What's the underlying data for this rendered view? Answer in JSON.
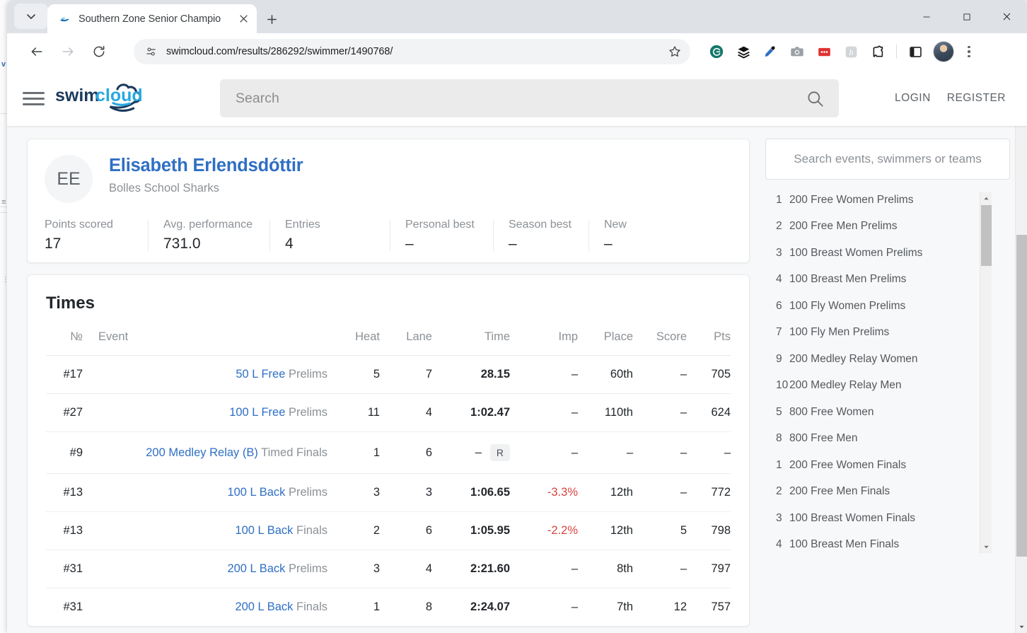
{
  "browser": {
    "tab": {
      "title": "Southern Zone Senior Champio",
      "favicon_name": "swimcloud-favicon"
    },
    "new_tab_label": "+",
    "url": "swimcloud.com/results/286292/swimmer/1490768/",
    "window_controls": {
      "minimize": "—",
      "maximize": "□",
      "close": "✕"
    },
    "extensions": [
      {
        "name": "grammarly-extension-icon",
        "label": "G"
      },
      {
        "name": "layers-extension-icon",
        "label": ""
      },
      {
        "name": "eyedropper-extension-icon",
        "label": ""
      },
      {
        "name": "screenshot-camera-extension-icon",
        "label": ""
      },
      {
        "name": "red-dots-extension-icon",
        "label": ""
      },
      {
        "name": "honey-extension-icon",
        "label": "h"
      },
      {
        "name": "extensions-puzzle-icon",
        "label": ""
      }
    ],
    "side_panel_name": "side-panel-icon",
    "profile_name": "chrome-profile-avatar",
    "menu_name": "chrome-menu-icon"
  },
  "site_header": {
    "logo_text_1": "swim",
    "logo_text_2": "cloud",
    "search_placeholder": "Search",
    "login_label": "LOGIN",
    "register_label": "REGISTER"
  },
  "profile": {
    "initials": "EE",
    "name": "Elisabeth Erlendsdóttir",
    "team": "Bolles School Sharks",
    "stats": [
      {
        "label": "Points scored",
        "value": "17"
      },
      {
        "label": "Avg. performance",
        "value": "731.0"
      },
      {
        "label": "Entries",
        "value": "4"
      },
      {
        "label": "Personal best",
        "value": "–"
      },
      {
        "label": "Season best",
        "value": "–"
      },
      {
        "label": "New",
        "value": "–"
      }
    ]
  },
  "times": {
    "title": "Times",
    "columns": [
      "№",
      "Event",
      "Heat",
      "Lane",
      "Time",
      "Imp",
      "Place",
      "Score",
      "Pts"
    ],
    "rows": [
      {
        "no": "#17",
        "event": "50 L Free",
        "round": "Prelims",
        "heat": "5",
        "lane": "7",
        "time": "28.15",
        "badge": "",
        "imp": "–",
        "place": "60th",
        "score": "–",
        "pts": "705"
      },
      {
        "no": "#27",
        "event": "100 L Free",
        "round": "Prelims",
        "heat": "11",
        "lane": "4",
        "time": "1:02.47",
        "badge": "",
        "imp": "–",
        "place": "110th",
        "score": "–",
        "pts": "624"
      },
      {
        "no": "#9",
        "event": "200 Medley Relay (B)",
        "round": "Timed Finals",
        "heat": "1",
        "lane": "6",
        "time": "–",
        "badge": "R",
        "imp": "–",
        "place": "–",
        "score": "–",
        "pts": "–"
      },
      {
        "no": "#13",
        "event": "100 L Back",
        "round": "Prelims",
        "heat": "3",
        "lane": "3",
        "time": "1:06.65",
        "badge": "",
        "imp": "-3.3%",
        "place": "12th",
        "score": "–",
        "pts": "772"
      },
      {
        "no": "#13",
        "event": "100 L Back",
        "round": "Finals",
        "heat": "2",
        "lane": "6",
        "time": "1:05.95",
        "badge": "",
        "imp": "-2.2%",
        "place": "12th",
        "score": "5",
        "pts": "798"
      },
      {
        "no": "#31",
        "event": "200 L Back",
        "round": "Prelims",
        "heat": "3",
        "lane": "4",
        "time": "2:21.60",
        "badge": "",
        "imp": "–",
        "place": "8th",
        "score": "–",
        "pts": "797"
      },
      {
        "no": "#31",
        "event": "200 L Back",
        "round": "Finals",
        "heat": "1",
        "lane": "8",
        "time": "2:24.07",
        "badge": "",
        "imp": "–",
        "place": "7th",
        "score": "12",
        "pts": "757"
      }
    ]
  },
  "sidebar": {
    "search_placeholder": "Search events, swimmers or teams",
    "events": [
      {
        "num": "1",
        "label": "200 Free Women Prelims"
      },
      {
        "num": "2",
        "label": "200 Free Men Prelims"
      },
      {
        "num": "3",
        "label": "100 Breast Women Prelims"
      },
      {
        "num": "4",
        "label": "100 Breast Men Prelims"
      },
      {
        "num": "6",
        "label": "100 Fly Women Prelims"
      },
      {
        "num": "7",
        "label": "100 Fly Men Prelims"
      },
      {
        "num": "9",
        "label": "200 Medley Relay Women"
      },
      {
        "num": "10",
        "label": "200 Medley Relay Men"
      },
      {
        "num": "5",
        "label": "800 Free Women"
      },
      {
        "num": "8",
        "label": "800 Free Men"
      },
      {
        "num": "1",
        "label": "200 Free Women Finals"
      },
      {
        "num": "2",
        "label": "200 Free Men Finals"
      },
      {
        "num": "3",
        "label": "100 Breast Women Finals"
      },
      {
        "num": "4",
        "label": "100 Breast Men Finals"
      }
    ]
  },
  "colors": {
    "link_blue": "#2f6fc4",
    "negative_red": "#d9443f",
    "muted_gray": "#8c9196",
    "logo_dark": "#1b3a5c",
    "logo_light": "#28a8e0"
  }
}
